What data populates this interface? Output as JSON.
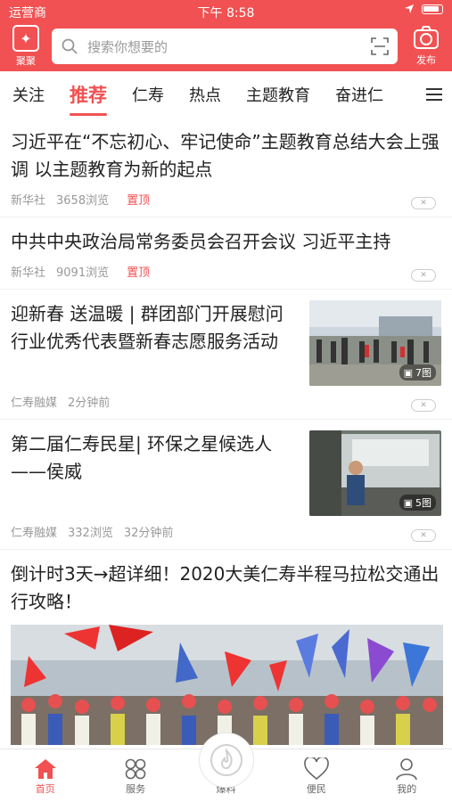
{
  "status": {
    "carrier": "运营商",
    "time": "下午 8:58"
  },
  "header": {
    "logo_label": "聚聚",
    "search_placeholder": "搜索你想要的",
    "publish_label": "发布"
  },
  "tabs": [
    "关注",
    "推荐",
    "仁寿",
    "热点",
    "主题教育",
    "奋进仁"
  ],
  "feed": [
    {
      "title": "习近平在“不忘初心、牢记使命”主题教育总结大会上强调 以主题教育为新的起点",
      "source": "新华社",
      "views": "3658浏览",
      "tag": "置顶"
    },
    {
      "title": "中共中央政治局常务委员会召开会议 习近平主持",
      "source": "新华社",
      "views": "9091浏览",
      "tag": "置顶"
    },
    {
      "title": "迎新春 送温暖 | 群团部门开展慰问行业优秀代表暨新春志愿服务活动",
      "source": "仁寿融媒",
      "time": "2分钟前",
      "photos": "7图"
    },
    {
      "title": "第二届仁寿民星| 环保之星候选人——侯威",
      "source": "仁寿融媒",
      "views": "332浏览",
      "time": "32分钟前",
      "photos": "5图"
    },
    {
      "title": "倒计时3天→超详细！2020大美仁寿半程马拉松交通出行攻略！"
    }
  ],
  "bottom_nav": [
    "首页",
    "服务",
    "爆料",
    "便民",
    "我的"
  ],
  "colors": {
    "accent": "#f15152"
  }
}
